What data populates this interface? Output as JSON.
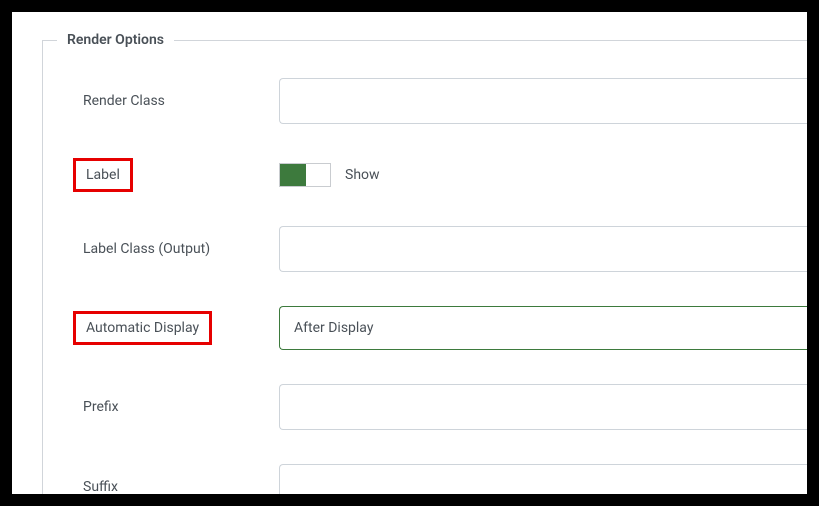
{
  "section": {
    "title": "Render Options"
  },
  "fields": {
    "renderClass": {
      "label": "Render Class",
      "value": ""
    },
    "label": {
      "label": "Label",
      "toggleState": "on",
      "toggleText": "Show"
    },
    "labelClass": {
      "label": "Label Class (Output)",
      "value": ""
    },
    "autoDisplay": {
      "label": "Automatic Display",
      "selected": "After Display"
    },
    "prefix": {
      "label": "Prefix",
      "value": ""
    },
    "suffix": {
      "label": "Suffix",
      "value": ""
    }
  }
}
